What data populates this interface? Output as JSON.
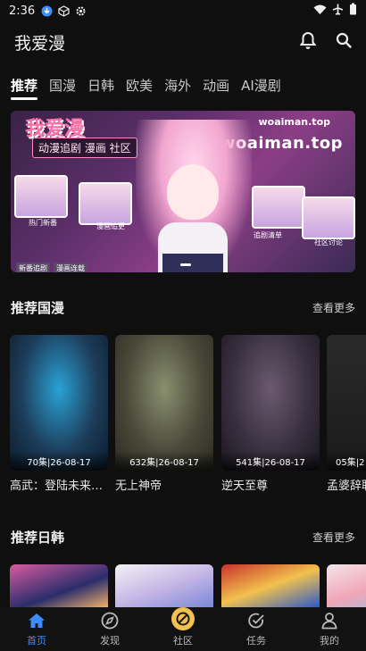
{
  "status": {
    "time": "2:36",
    "icons": [
      "download-icon",
      "cube-icon",
      "settings-icon",
      "wifi-icon",
      "airplane-icon",
      "battery-icon"
    ]
  },
  "app": {
    "title": "我爱漫"
  },
  "tabs": [
    {
      "label": "推荐",
      "active": true
    },
    {
      "label": "国漫"
    },
    {
      "label": "日韩"
    },
    {
      "label": "欧美"
    },
    {
      "label": "海外"
    },
    {
      "label": "动画"
    },
    {
      "label": "AI漫剧"
    }
  ],
  "banner": {
    "brand": "我爱漫",
    "site": "woaiman.top",
    "site_small": "woaiman.top",
    "tagline": "动漫追剧 漫画 社区",
    "captions": [
      "热门新番",
      "漫画追更",
      "追剧清单",
      "社区讨论",
      "新番追剧",
      "漫画连载"
    ]
  },
  "sections": [
    {
      "title": "推荐国漫",
      "more": "查看更多",
      "items": [
        {
          "name": "高武：登陆未来一…",
          "ep": "70集|26-08-17",
          "colors": [
            "#1d3d5a",
            "#2aa2d6",
            "#0b1b2b"
          ]
        },
        {
          "name": "无上神帝",
          "ep": "632集|26-08-17",
          "colors": [
            "#4a4a3a",
            "#8a8f6f",
            "#2a2a22"
          ]
        },
        {
          "name": "逆天至尊",
          "ep": "541集|26-08-17",
          "colors": [
            "#3a3140",
            "#6b5a70",
            "#1a1620"
          ]
        },
        {
          "name": "孟婆辞职",
          "ep": "05集|2",
          "colors": [
            "#2a2a2a",
            "#555555",
            "#1a1a1a"
          ]
        }
      ]
    },
    {
      "title": "推荐日韩",
      "more": "查看更多",
      "items": [
        {
          "colors": [
            "#2b2d6b",
            "#d85ba0",
            "#f0b06a"
          ]
        },
        {
          "colors": [
            "#c8b8e6",
            "#f2f2f6",
            "#7a88d8"
          ]
        },
        {
          "colors": [
            "#c8322c",
            "#f2c14e",
            "#2c5ac8"
          ]
        },
        {
          "colors": [
            "#f0a6b8",
            "#f4e4ea",
            "#8ac0e6"
          ]
        }
      ]
    }
  ],
  "nav": [
    {
      "label": "首页",
      "icon": "home-icon",
      "active": true
    },
    {
      "label": "发现",
      "icon": "compass-icon"
    },
    {
      "label": "社区",
      "icon": "community-icon"
    },
    {
      "label": "任务",
      "icon": "task-check-icon"
    },
    {
      "label": "我的",
      "icon": "profile-icon"
    }
  ],
  "colors": {
    "background": "#0f0f10",
    "accent": "#3f8cff",
    "community": "#f2c14e"
  }
}
